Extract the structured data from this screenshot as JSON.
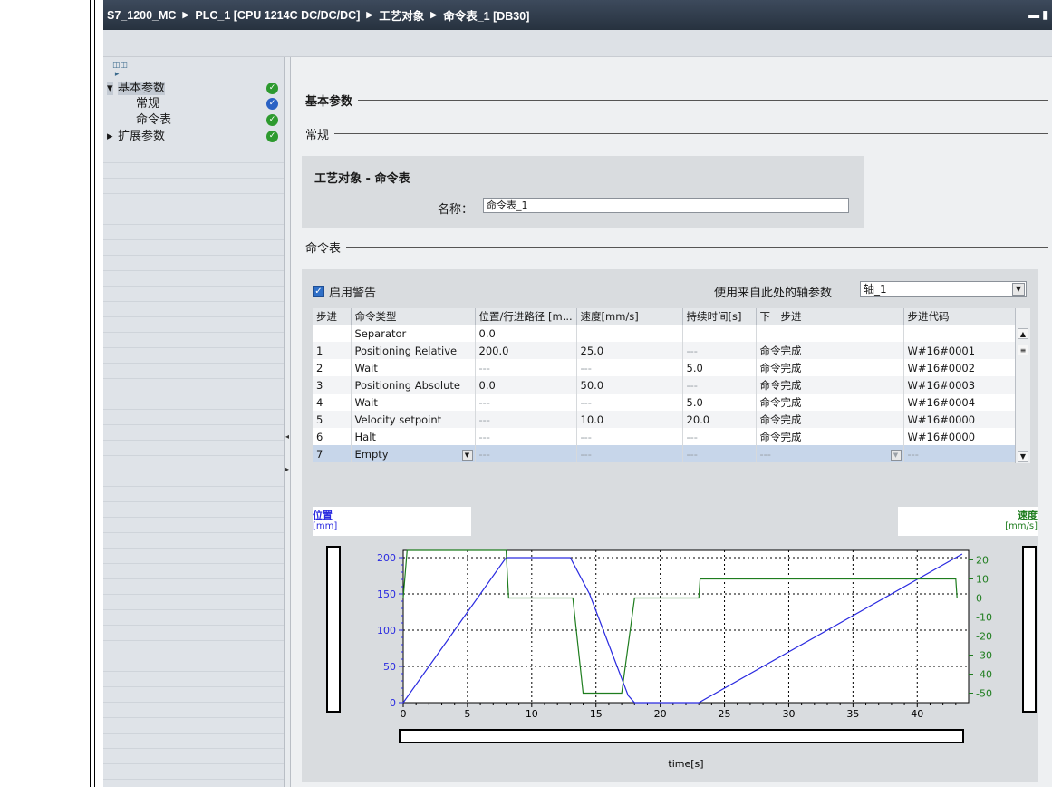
{
  "titlebar": {
    "crumbs": [
      "S7_1200_MC",
      "PLC_1 [CPU 1214C DC/DC/DC]",
      "工艺对象",
      "命令表_1 [DB30]"
    ]
  },
  "nav": {
    "items": [
      {
        "label": "基本参数",
        "status": "ok-green",
        "expanded": true
      },
      {
        "label": "常规",
        "status": "ok-blue"
      },
      {
        "label": "命令表",
        "status": "ok-green"
      },
      {
        "label": "扩展参数",
        "status": "ok-green",
        "expanded": false
      }
    ]
  },
  "content": {
    "section_basic": "基本参数",
    "section_general": "常规",
    "techobj_title": "工艺对象 - 命令表",
    "name_label": "名称：",
    "name_value": "命令表_1",
    "section_cmdtable": "命令表",
    "enable_warning": "启用警告",
    "use_axis_label": "使用来自此处的轴参数",
    "axis_value": "轴_1"
  },
  "table": {
    "headers": [
      "步进",
      "命令类型",
      "位置/行进路径 [m...",
      "速度[mm/s]",
      "持续时间[s]",
      "下一步进",
      "步进代码"
    ],
    "rows": [
      [
        "",
        "Separator",
        "0.0",
        "",
        "",
        "",
        ""
      ],
      [
        "1",
        "Positioning Relative",
        "200.0",
        "25.0",
        "---",
        "命令完成",
        "W#16#0001"
      ],
      [
        "2",
        "Wait",
        "---",
        "---",
        "5.0",
        "命令完成",
        "W#16#0002"
      ],
      [
        "3",
        "Positioning Absolute",
        "0.0",
        "50.0",
        "---",
        "命令完成",
        "W#16#0003"
      ],
      [
        "4",
        "Wait",
        "---",
        "---",
        "5.0",
        "命令完成",
        "W#16#0004"
      ],
      [
        "5",
        "Velocity setpoint",
        "---",
        "10.0",
        "20.0",
        "命令完成",
        "W#16#0000"
      ],
      [
        "6",
        "Halt",
        "---",
        "---",
        "---",
        "命令完成",
        "W#16#0000"
      ],
      [
        "7",
        "Empty",
        "---",
        "---",
        "---",
        "---",
        "---"
      ]
    ]
  },
  "chart_data": {
    "type": "line",
    "left_axis_title": "位置",
    "left_axis_unit": "[mm]",
    "right_axis_title": "速度",
    "right_axis_unit": "[mm/s]",
    "xlabel": "time[s]",
    "xlim": [
      0,
      44
    ],
    "x_ticks": [
      0,
      5,
      10,
      15,
      20,
      25,
      30,
      35,
      40
    ],
    "ylim_left": [
      0,
      210
    ],
    "y_ticks_left": [
      0,
      50,
      100,
      150,
      200
    ],
    "ylim_right": [
      -55,
      25
    ],
    "y_ticks_right": [
      20,
      10,
      0,
      -10,
      -20,
      -30,
      -40,
      -50
    ],
    "grid": true,
    "series": [
      {
        "name": "位置",
        "color": "#2a2ae0",
        "axis": "left",
        "x": [
          0,
          8,
          13,
          14.5,
          16,
          17.5,
          18,
          23,
          43.5
        ],
        "y": [
          0,
          200,
          200,
          150,
          80,
          10,
          0,
          0,
          205
        ]
      },
      {
        "name": "速度",
        "color": "#1e7d1e",
        "axis": "right",
        "x": [
          0,
          0.3,
          8,
          8.2,
          13.2,
          14,
          17,
          18,
          23,
          23.1,
          43,
          43.1
        ],
        "y": [
          0,
          25,
          25,
          0,
          0,
          -50,
          -50,
          0,
          0,
          10,
          10,
          0
        ]
      }
    ]
  },
  "colors": {
    "titlebar": "#2f3a48",
    "position_series": "#2a2ae0",
    "speed_series": "#1e7d1e",
    "status_green": "#2d9a2f",
    "status_blue": "#2a62c4"
  }
}
